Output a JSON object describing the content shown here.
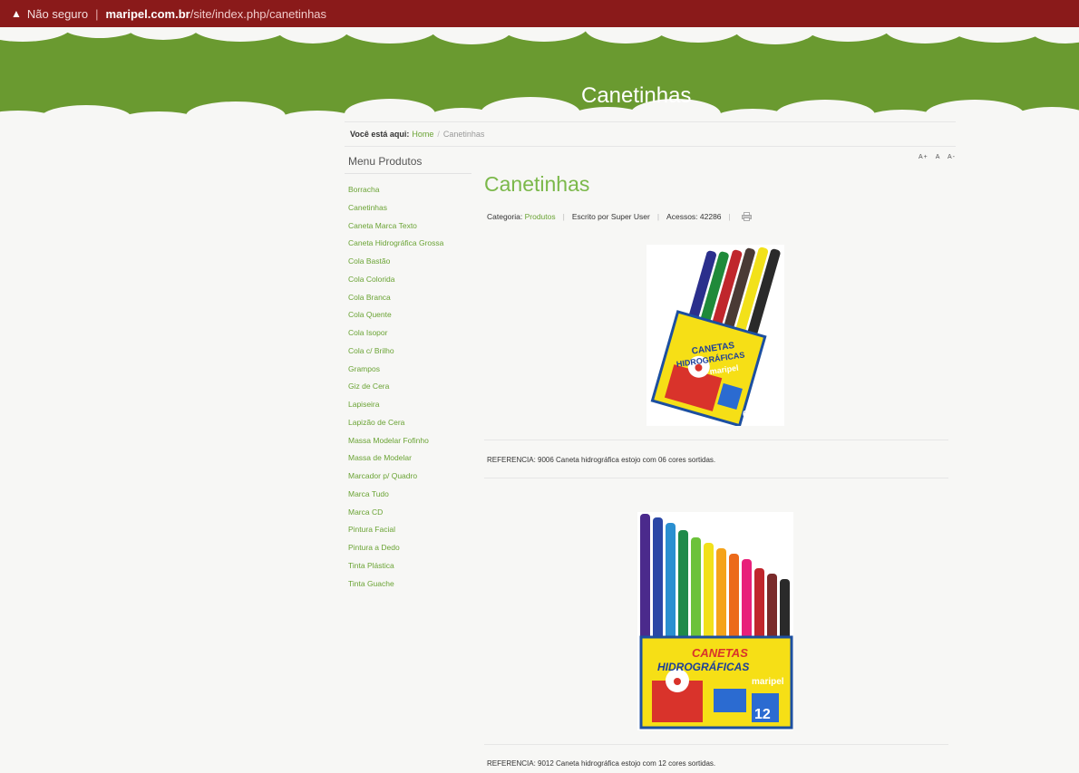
{
  "browser": {
    "security_label": "Não seguro",
    "url_domain": "maripel.com.br",
    "url_path": "/site/index.php/canetinhas"
  },
  "banner": {
    "title": "Canetinhas",
    "background_color": "#6a9a30"
  },
  "breadcrumb": {
    "label": "Você está aqui:",
    "home": "Home",
    "separator": "/",
    "current": "Canetinhas"
  },
  "sidebar": {
    "title": "Menu Produtos",
    "items": [
      "Borracha",
      "Canetinhas",
      "Caneta Marca Texto",
      "Caneta Hidrográfica Grossa",
      "Cola Bastão",
      "Cola Colorida",
      "Cola Branca",
      "Cola Quente",
      "Cola Isopor",
      "Cola c/ Brilho",
      "Grampos",
      "Giz de Cera",
      "Lapiseira",
      "Lapizão de Cera",
      "Massa Modelar Fofinho",
      "Massa de Modelar",
      "Marcador p/ Quadro",
      "Marca Tudo",
      "Marca CD",
      "Pintura Facial",
      "Pintura a Dedo",
      "Tinta Plástica",
      "Tinta Guache"
    ]
  },
  "font_controls": {
    "increase": "A+",
    "reset": "A",
    "decrease": "A-"
  },
  "article": {
    "title": "Canetinhas",
    "category_label": "Categoria:",
    "category_value": "Produtos",
    "author": "Escrito por Super User",
    "hits": "Acessos: 42286",
    "products": [
      {
        "reference": "REFERENCIA: 9006 Caneta hidrográfica estojo com 06 cores sortidas.",
        "box_text_line1": "CANETAS",
        "box_text_line2": "HIDROGRÁFICAS",
        "brand": "maripel",
        "count": "6",
        "pen_colors": [
          "#2b2f8c",
          "#1f8a3a",
          "#c0262c",
          "#4a3a35",
          "#f2e11a",
          "#2a2a2a"
        ]
      },
      {
        "reference": "REFERENCIA: 9012 Caneta hidrográfica estojo com 12 cores sortidas.",
        "box_text_line1": "CANETAS",
        "box_text_line2": "HIDROGRÁFICAS",
        "brand": "maripel",
        "count": "12",
        "pen_colors": [
          "#4b2a8c",
          "#2b47a6",
          "#2a8fd0",
          "#1f8a4a",
          "#6cc23a",
          "#f2e11a",
          "#f5a31a",
          "#ec6a1a",
          "#e8207a",
          "#c0262c",
          "#7a2a2a",
          "#2a2a2a"
        ]
      }
    ]
  }
}
